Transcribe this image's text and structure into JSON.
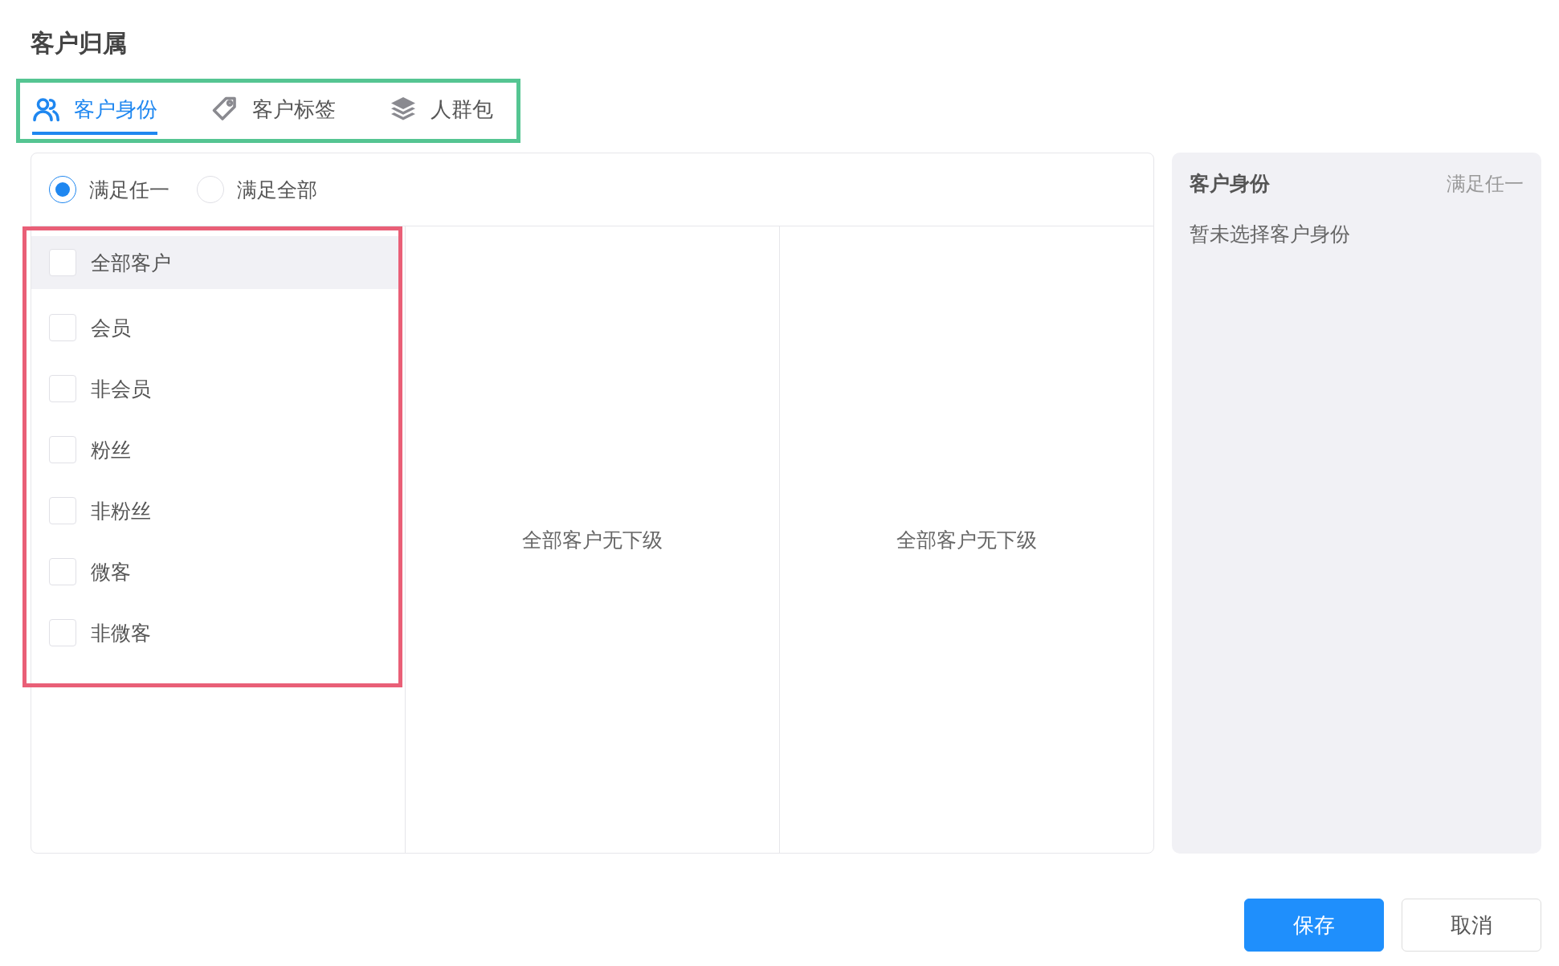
{
  "title": "客户归属",
  "tabs": [
    {
      "label": "客户身份",
      "selected": true,
      "kind": "users"
    },
    {
      "label": "客户标签",
      "selected": false,
      "kind": "tag"
    },
    {
      "label": "人群包",
      "selected": false,
      "kind": "layers"
    }
  ],
  "match_options": [
    {
      "label": "满足任一",
      "selected": true
    },
    {
      "label": "满足全部",
      "selected": false
    }
  ],
  "items": [
    {
      "label": "全部客户",
      "checked": false,
      "selected": true
    },
    {
      "label": "会员",
      "checked": false,
      "selected": false
    },
    {
      "label": "非会员",
      "checked": false,
      "selected": false
    },
    {
      "label": "粉丝",
      "checked": false,
      "selected": false
    },
    {
      "label": "非粉丝",
      "checked": false,
      "selected": false
    },
    {
      "label": "微客",
      "checked": false,
      "selected": false
    },
    {
      "label": "非微客",
      "checked": false,
      "selected": false
    }
  ],
  "sub_columns": [
    "全部客户无下级",
    "全部客户无下级"
  ],
  "summary": {
    "title": "客户身份",
    "mode": "满足任一",
    "empty_text": "暂未选择客户身份"
  },
  "buttons": [
    {
      "label": "保存",
      "kind": "primary"
    },
    {
      "label": "取消",
      "kind": "default"
    }
  ]
}
